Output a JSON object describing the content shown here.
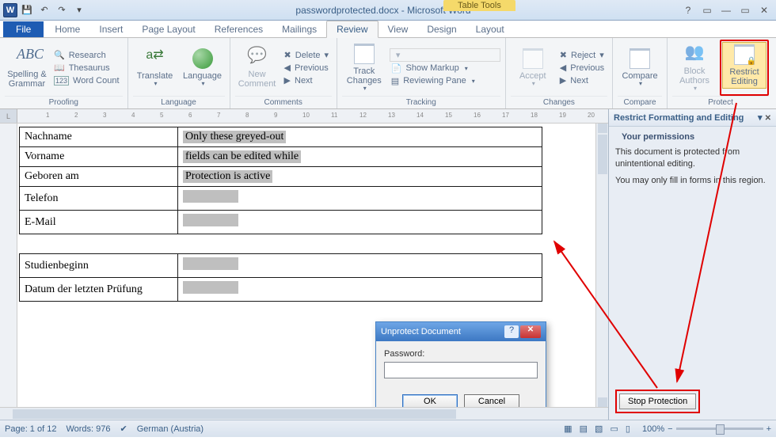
{
  "title": {
    "doc": "passwordprotected.docx",
    "app": "Microsoft Word"
  },
  "contextual_tab": "Table Tools",
  "tabs": {
    "file": "File",
    "home": "Home",
    "insert": "Insert",
    "page_layout": "Page Layout",
    "references": "References",
    "mailings": "Mailings",
    "review": "Review",
    "view": "View",
    "design": "Design",
    "layout": "Layout"
  },
  "ribbon": {
    "proofing": {
      "spelling": "Spelling & Grammar",
      "research": "Research",
      "thesaurus": "Thesaurus",
      "word_count": "Word Count",
      "group": "Proofing"
    },
    "language": {
      "translate": "Translate",
      "language": "Language",
      "group": "Language"
    },
    "comments": {
      "new": "New Comment",
      "delete": "Delete",
      "previous": "Previous",
      "next": "Next",
      "group": "Comments"
    },
    "tracking": {
      "track": "Track Changes",
      "show_markup": "Show Markup",
      "reviewing_pane": "Reviewing Pane",
      "group": "Tracking"
    },
    "changes": {
      "accept": "Accept",
      "reject": "Reject",
      "previous": "Previous",
      "next": "Next",
      "group": "Changes"
    },
    "compare": {
      "compare": "Compare",
      "group": "Compare"
    },
    "protect": {
      "block": "Block Authors",
      "restrict": "Restrict Editing",
      "group": "Protect"
    }
  },
  "pane": {
    "title": "Restrict Formatting and Editing",
    "section": "Your permissions",
    "line1": "This document is protected from unintentional editing.",
    "line2": "You may only fill in forms in this region.",
    "stop": "Stop Protection"
  },
  "dialog": {
    "title": "Unprotect Document",
    "label": "Password:",
    "ok": "OK",
    "cancel": "Cancel",
    "value": ""
  },
  "form": {
    "rows1": [
      {
        "label": "Nachname",
        "value": "Only these greyed-out"
      },
      {
        "label": "Vorname",
        "value": "fields can be edited while"
      },
      {
        "label": "Geboren am",
        "value": "Protection is active"
      },
      {
        "label": "Telefon",
        "value": ""
      },
      {
        "label": "E-Mail",
        "value": ""
      }
    ],
    "rows2": [
      {
        "label": "Studienbeginn",
        "value": ""
      },
      {
        "label": "Datum der letzten Prüfung",
        "value": ""
      }
    ]
  },
  "status": {
    "page": "Page: 1 of 12",
    "words": "Words: 976",
    "lang": "German (Austria)",
    "zoom": "100%"
  }
}
